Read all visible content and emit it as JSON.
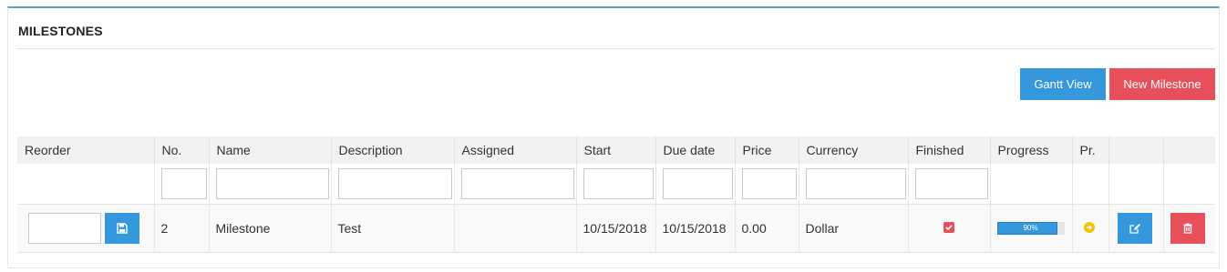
{
  "panel": {
    "title": "MILESTONES",
    "gantt_label": "Gantt View",
    "new_label": "New Milestone"
  },
  "table": {
    "headers": [
      "Reorder",
      "No.",
      "Name",
      "Description",
      "Assigned",
      "Start",
      "Due date",
      "Price",
      "Currency",
      "Finished",
      "Progress",
      "Pr.",
      "",
      ""
    ],
    "rows": [
      {
        "no": "2",
        "name": "Milestone",
        "description": "Test",
        "assigned": "",
        "start": "10/15/2018",
        "due": "10/15/2018",
        "price": "0.00",
        "currency": "Dollar",
        "finished": true,
        "progress": 90,
        "progress_label": "90%"
      }
    ]
  },
  "icons": {
    "save": "floppy-disk-icon",
    "finished": "check-square-icon",
    "priority": "arrow-circle-right-icon",
    "edit": "edit-icon",
    "delete": "trash-icon"
  },
  "colors": {
    "accent": "#3598dc",
    "danger": "#e7505a",
    "warning": "#f3c200"
  }
}
